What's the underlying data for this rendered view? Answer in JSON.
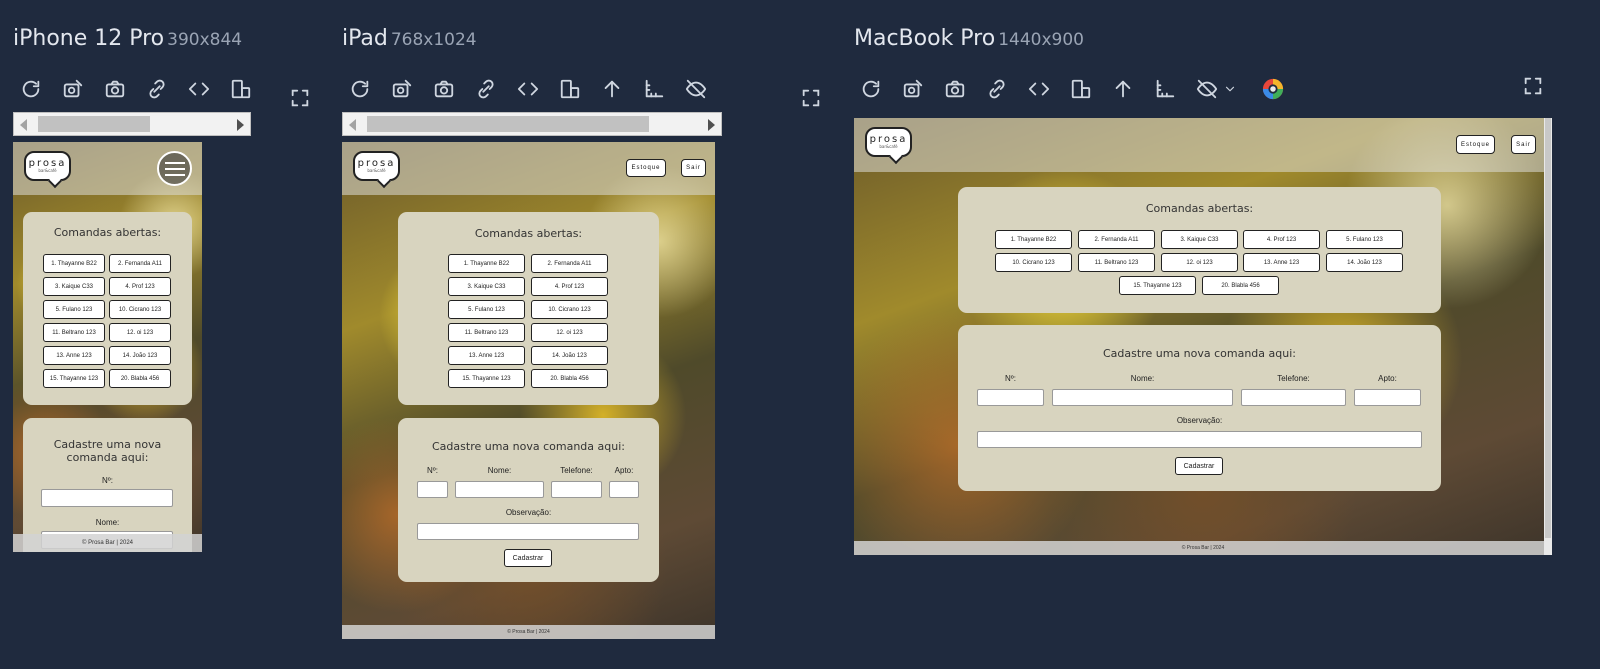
{
  "devices": {
    "iphone": {
      "name": "iPhone 12 Pro",
      "size": "390x844"
    },
    "ipad": {
      "name": "iPad",
      "size": "768x1024"
    },
    "macbook": {
      "name": "MacBook Pro",
      "size": "1440x900"
    }
  },
  "toolbar_icons": [
    "refresh-icon",
    "screenshot-edit-icon",
    "camera-icon",
    "link-icon",
    "code-icon",
    "rotate-device-icon",
    "arrow-up-icon",
    "ruler-icon",
    "eye-off-icon",
    "chevron-down-icon",
    "color-picker-icon",
    "expand-icon"
  ],
  "site": {
    "logo_word": "prosa",
    "logo_sub": "bar&café",
    "stock_button": "Estoque",
    "logout_button": "Sair",
    "open_orders_title": "Comandas abertas:",
    "orders": [
      "1. Thayanne B22",
      "2. Fernanda A11",
      "3. Kaique C33",
      "4. Prof 123",
      "5. Fulano 123",
      "10. Cicrano 123",
      "11. Beltrano 123",
      "12. oi 123",
      "13. Anne 123",
      "14. João 123",
      "15. Thayanne 123",
      "20. Blabla 456"
    ],
    "new_order_title": "Cadastre uma nova comanda aqui:",
    "new_order_title_mobile_1": "Cadastre uma nova",
    "new_order_title_mobile_2": "comanda aqui:",
    "field_number": "Nº:",
    "field_name": "Nome:",
    "field_phone": "Telefone:",
    "field_apt": "Apto:",
    "field_notes": "Observação:",
    "submit_button": "Cadastrar",
    "footer": "© Prosa Bar | 2024"
  },
  "colors": {
    "page_bg": "#1f2a3e",
    "card_bg": "#d8d4bf",
    "header_bg": "#dcdcd7"
  }
}
